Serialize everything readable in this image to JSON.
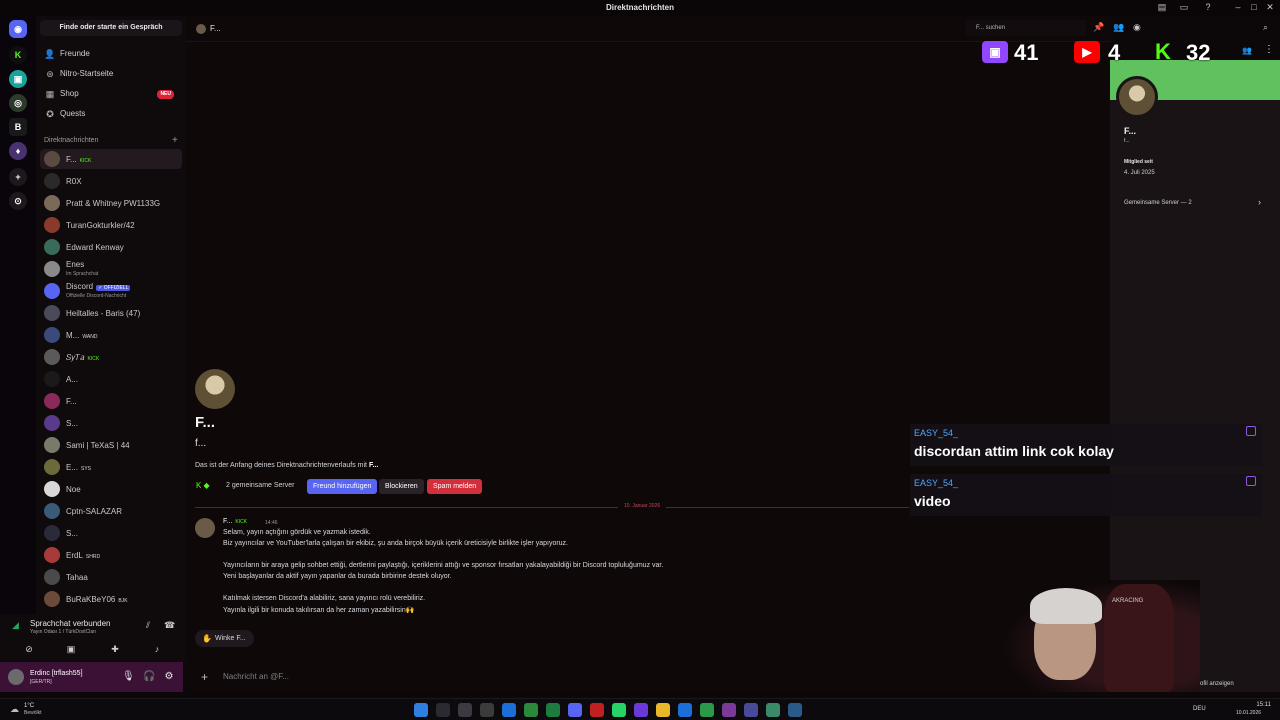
{
  "window": {
    "title": "Direktnachrichten"
  },
  "sidebar": {
    "search": "Finde oder starte ein Gespräch",
    "nav": [
      {
        "label": "Freunde",
        "icon": "friends-icon"
      },
      {
        "label": "Nitro-Startseite",
        "icon": "nitro-icon"
      },
      {
        "label": "Shop",
        "icon": "shop-icon",
        "badge": "NEU"
      },
      {
        "label": "Quests",
        "icon": "quests-icon"
      }
    ],
    "dm_header": "Direktnachrichten",
    "dms": [
      {
        "name": "F...",
        "tag": "KICK"
      },
      {
        "name": "R0X"
      },
      {
        "name": "Pratt & Whitney PW1133G"
      },
      {
        "name": "TuranGokturkler/42"
      },
      {
        "name": "Edward Kenway"
      },
      {
        "name": "Enes",
        "sub": "Im Sprachchat"
      },
      {
        "name": "Discord",
        "tag": "✓ OFFIZIELL",
        "sub": "Offizielle Discord-Nachricht"
      },
      {
        "name": "Heiltalles - Baris (47)"
      },
      {
        "name": "M...",
        "tag": "WAND"
      },
      {
        "name": "𝑆𝑦𝑇𝑎",
        "tag": "KICK"
      },
      {
        "name": "A..."
      },
      {
        "name": "F..."
      },
      {
        "name": "S..."
      },
      {
        "name": "Sami | TeXaS | 44"
      },
      {
        "name": "E...",
        "tag": "SYS"
      },
      {
        "name": "Noe"
      },
      {
        "name": "Cptn-SALAZAR"
      },
      {
        "name": "S..."
      },
      {
        "name": "ErdL",
        "tag": "SHRD"
      },
      {
        "name": "Tahaa"
      },
      {
        "name": "BuRaKBeY06",
        "tag": "BJK"
      }
    ]
  },
  "voice": {
    "status": "Sprachchat verbunden",
    "channel": "Yayın Odası 1 / TürkDostClan"
  },
  "user": {
    "name": "Erdinc [trflash55]",
    "sub": "[GER/TR]"
  },
  "chat": {
    "header_name": "F...",
    "header_search": "F... suchen",
    "name": "F...",
    "username": "f...",
    "intro": "Das ist der Anfang deines Direktnachrichtenverlaufs mit",
    "intro_name": "F...",
    "mutual": "2 gemeinsame Server",
    "btn_friend": "Freund hinzufügen",
    "btn_block": "Blockieren",
    "btn_spam": "Spam melden",
    "date": "10. Januar 2026",
    "message": {
      "author": "F...",
      "tag": "KICK",
      "time": "14:46",
      "lines": [
        "Selam, yayın açtığını gördük ve yazmak istedik.",
        "Biz yayıncılar ve YouTuber'larla çalışan bir ekibiz, şu anda birçok büyük içerik üreticisiyle birlikte işler yapıyoruz.",
        "Yayıncıların bir araya gelip sohbet ettiği, dertlerini paylaştığı, içeriklerini attığı ve sponsor fırsatları yakalayabildiği bir Discord topluluğumuz var.",
        "Yeni başlayanlar da aktif yayın yapanlar da burada birbirine destek oluyor.",
        "Katılmak istersen Discord'a alabiliriz, sana yayıncı rolü verebiliriz.",
        "Yayınla ilgili bir konuda takılırsan da her zaman yazabilirsin🙌"
      ]
    },
    "wave": "Winke F...",
    "composer_placeholder": "Nachricht an @F..."
  },
  "profile": {
    "name": "F...",
    "username": "f...",
    "member_since_label": "Mitglied seit",
    "member_since": "4. Juli 2025",
    "mutual_servers": "Gemeinsame Server — 2",
    "view_full": "Profil anzeigen"
  },
  "overlay": {
    "twitch_count": "41",
    "youtube_count": "4",
    "kick_count": "32",
    "chat": [
      {
        "user": "EASY_54_",
        "message": "discordan attim link cok kolay"
      },
      {
        "user": "EASY_54_",
        "message": "video"
      }
    ],
    "colors": {
      "twitch": "#9146ff",
      "youtube": "#ff0000",
      "kick": "#53fc18"
    }
  },
  "webcam": {
    "chair_text": "AKRACING"
  },
  "taskbar": {
    "weather": "1°C",
    "weather_sub": "Bewölkt",
    "lang": "DEU",
    "time": "15:11",
    "date": "10.01.2026"
  },
  "colors": {
    "accent": "#5865f2",
    "danger": "#d22e3c",
    "user_panel": "#3b1236"
  }
}
